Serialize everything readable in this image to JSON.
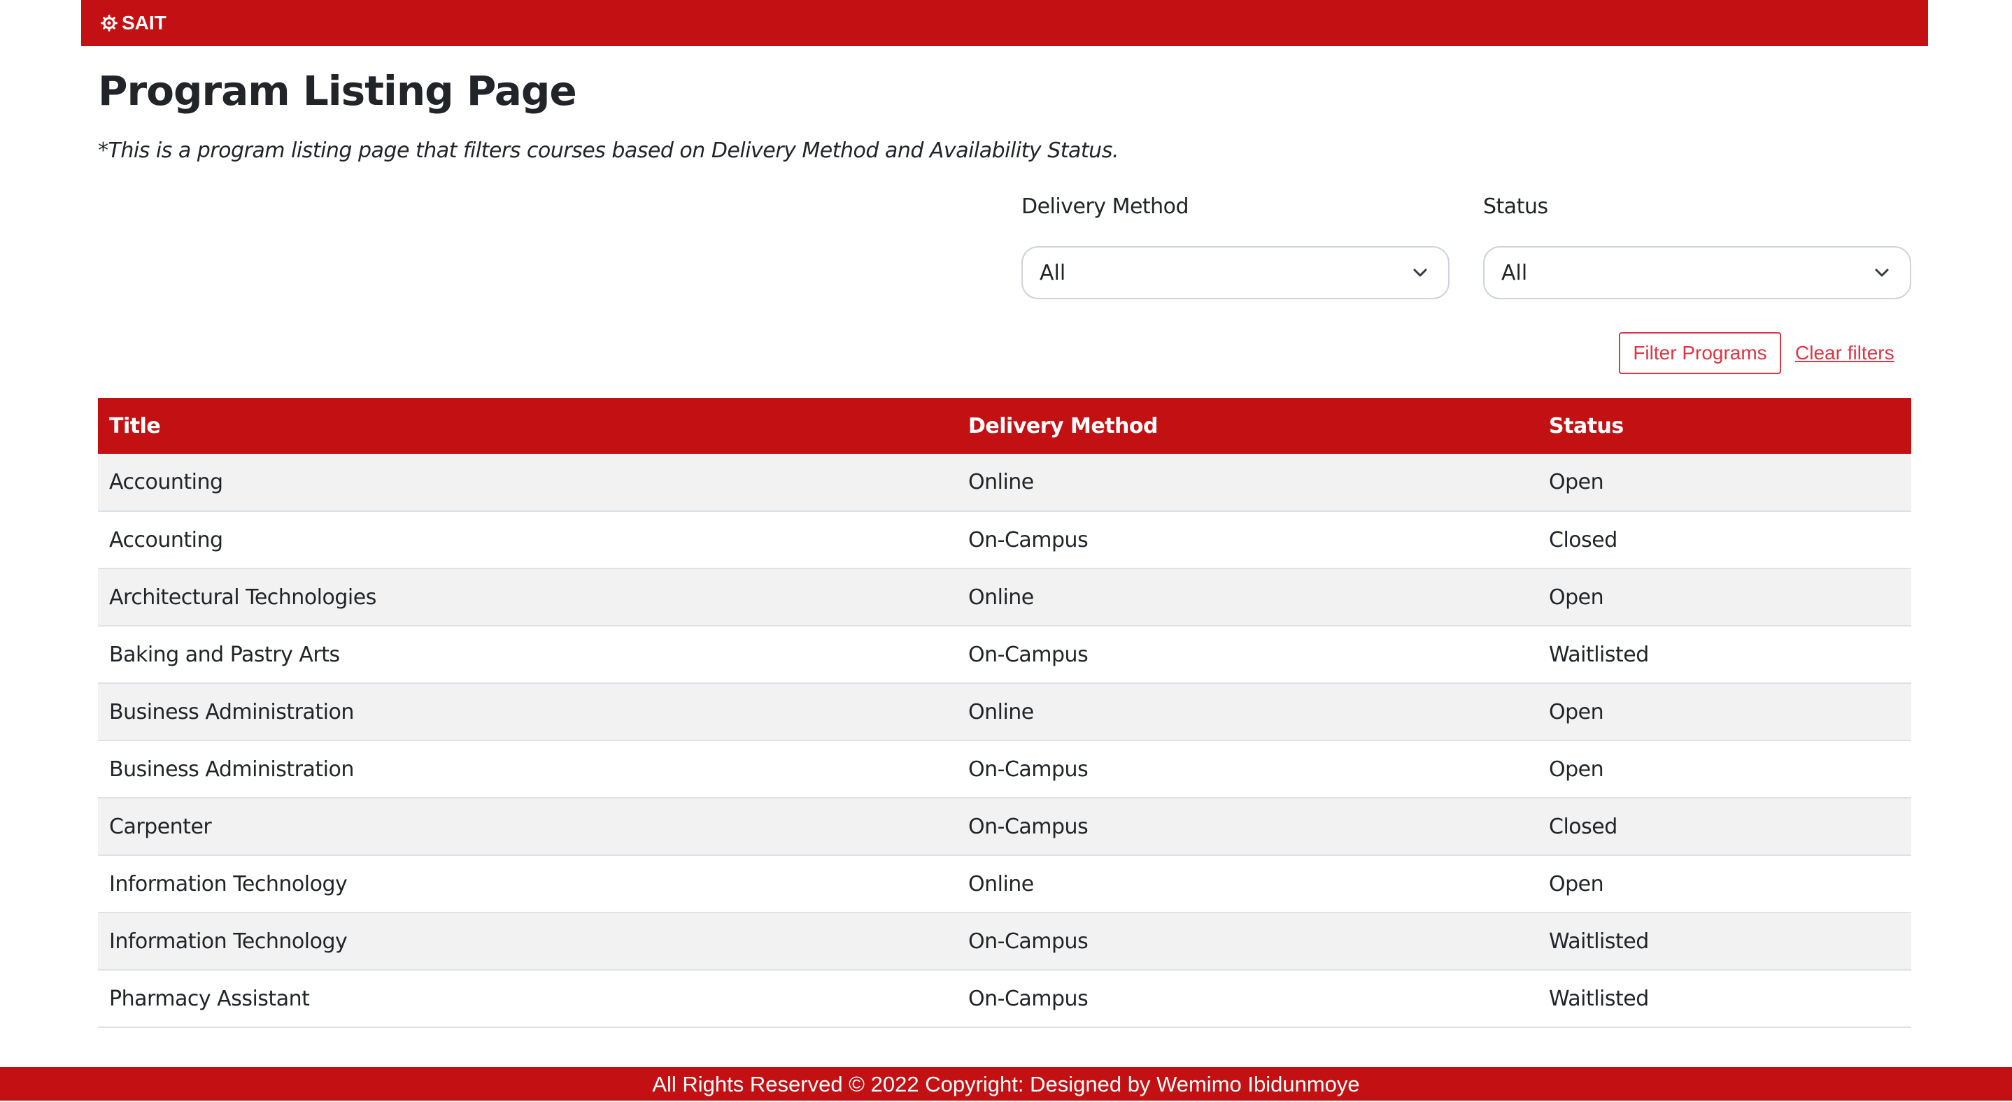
{
  "header": {
    "brand": "SAIT",
    "brand_icon": "gear-icon",
    "brand_color": "#c21013"
  },
  "page": {
    "title": "Program Listing Page",
    "subtitle": "*This is a program listing page that filters courses based on Delivery Method and Availability Status."
  },
  "filters": {
    "delivery": {
      "label": "Delivery Method",
      "value": "All"
    },
    "status": {
      "label": "Status",
      "value": "All"
    },
    "filter_button": "Filter Programs",
    "clear_link": "Clear filters",
    "accent_color": "#dc3545"
  },
  "table": {
    "headers": [
      "Title",
      "Delivery Method",
      "Status"
    ],
    "rows": [
      [
        "Accounting",
        "Online",
        "Open"
      ],
      [
        "Accounting",
        "On-Campus",
        "Closed"
      ],
      [
        "Architectural Technologies",
        "Online",
        "Open"
      ],
      [
        "Baking and Pastry Arts",
        "On-Campus",
        "Waitlisted"
      ],
      [
        "Business Administration",
        "Online",
        "Open"
      ],
      [
        "Business Administration",
        "On-Campus",
        "Open"
      ],
      [
        "Carpenter",
        "On-Campus",
        "Closed"
      ],
      [
        "Information Technology",
        "Online",
        "Open"
      ],
      [
        "Information Technology",
        "On-Campus",
        "Waitlisted"
      ],
      [
        "Pharmacy Assistant",
        "On-Campus",
        "Waitlisted"
      ]
    ]
  },
  "footer": {
    "text": "All Rights Reserved © 2022 Copyright: Designed by Wemimo Ibidunmoye"
  }
}
